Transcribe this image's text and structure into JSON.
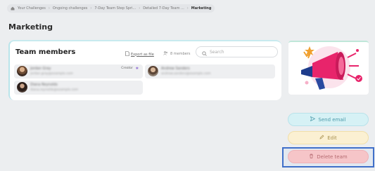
{
  "breadcrumb": {
    "items": [
      "Your Challenges",
      "Ongoing challenges",
      "7-Day Team Step Spri...",
      "Detailed 7-Day Team ...",
      "Marketing"
    ]
  },
  "page": {
    "title": "Marketing"
  },
  "team_card": {
    "title": "Team members",
    "export_label": "Export as file",
    "members_count": "8 members",
    "search_placeholder": "Search",
    "members": [
      {
        "name": "Jordan Gray",
        "email": "jordan.gray@example.com",
        "badge": "Creator"
      },
      {
        "name": "Andrew Sanders",
        "email": "andrew.sanders@example.com"
      },
      {
        "name": "Diana Reynolds",
        "email": "diana.reynolds@example.com"
      }
    ]
  },
  "actions": {
    "send_email": "Send email",
    "edit": "Edit",
    "delete_team": "Delete team"
  },
  "colors": {
    "accent_teal": "#b9e4ea",
    "megaphone_pink": "#e8246b",
    "highlight_blue": "#3f6fc9"
  }
}
